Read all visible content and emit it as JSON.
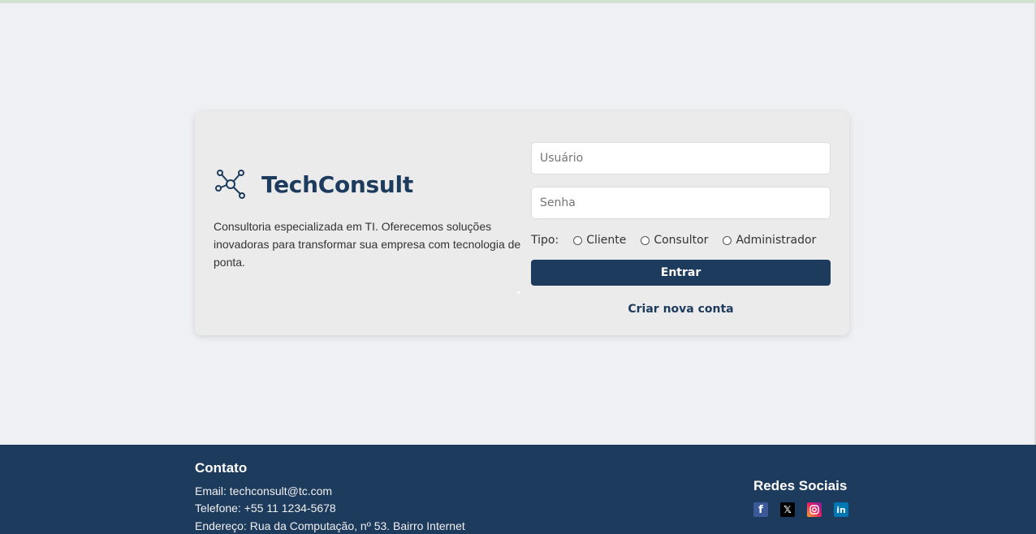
{
  "brand": {
    "name": "TechConsult",
    "logo_icon": "network-nodes-icon",
    "description": "Consultoria especializada em TI. Oferecemos soluções inovadoras para transformar sua empresa com tecnologia de ponta."
  },
  "login": {
    "username_placeholder": "Usuário",
    "password_placeholder": "Senha",
    "type_label": "Tipo:",
    "type_options": [
      "Cliente",
      "Consultor",
      "Administrador"
    ],
    "submit_label": "Entrar",
    "create_account_label": "Criar nova conta"
  },
  "footer": {
    "contact_title": "Contato",
    "email": "Email: techconsult@tc.com",
    "phone": "Telefone: +55 11 1234-5678",
    "address": "Endereço: Rua da Computação, nº 53. Bairro Internet",
    "social_title": "Redes Sociais",
    "social_icons": [
      "facebook-icon",
      "x-icon",
      "instagram-icon",
      "linkedin-icon"
    ]
  },
  "colors": {
    "primary": "#1d3b5c",
    "background": "#eff0f4",
    "card": "#ecebeb"
  }
}
